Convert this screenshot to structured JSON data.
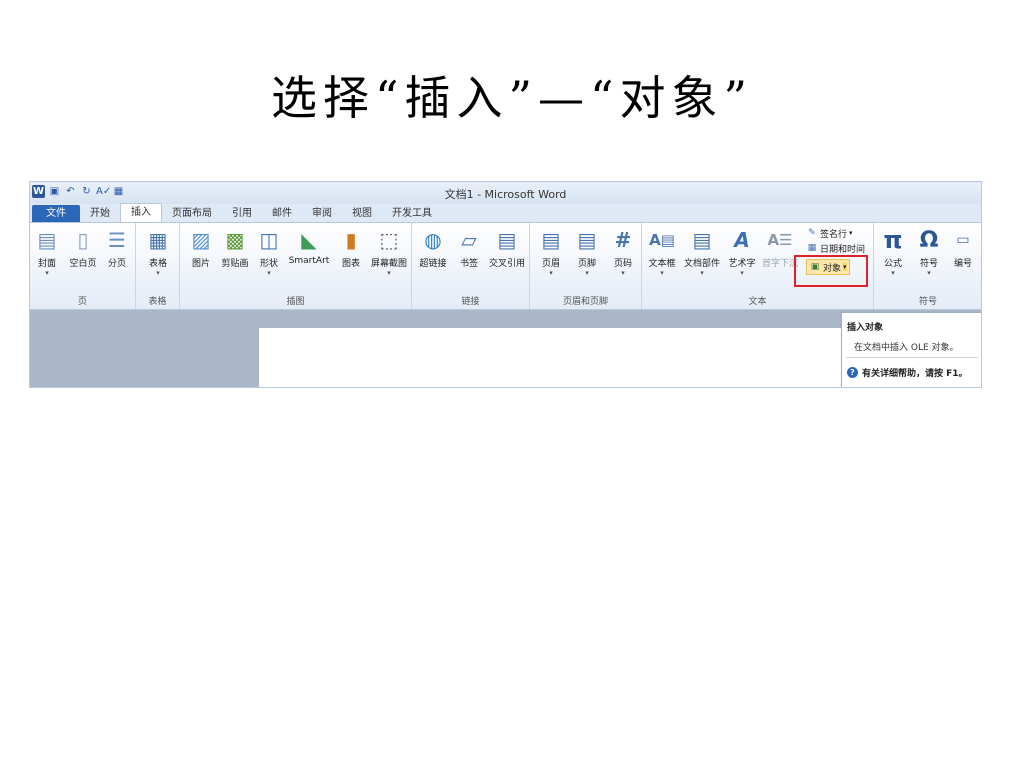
{
  "slide": {
    "title": "选择“插入”—“对象”"
  },
  "window": {
    "title": "文档1 - Microsoft Word",
    "qat": {
      "logo": "W",
      "save": "▣",
      "undo": "↶",
      "redo": "↻",
      "spell": "A✓",
      "table": "▦"
    }
  },
  "tabs": [
    {
      "label": "文件"
    },
    {
      "label": "开始"
    },
    {
      "label": "插入"
    },
    {
      "label": "页面布局"
    },
    {
      "label": "引用"
    },
    {
      "label": "邮件"
    },
    {
      "label": "审阅"
    },
    {
      "label": "视图"
    },
    {
      "label": "开发工具"
    }
  ],
  "ribbon": {
    "groups": {
      "pages": "页",
      "tables": "表格",
      "illustrations": "插图",
      "links": "链接",
      "header_footer": "页眉和页脚",
      "text": "文本",
      "symbols": "符号"
    },
    "buttons": {
      "cover": "封面",
      "blank_page": "空白页",
      "page_break": "分页",
      "table": "表格",
      "picture": "图片",
      "clipart": "剪贴画",
      "shapes": "形状",
      "smartart": "SmartArt",
      "chart": "图表",
      "screenshot": "屏幕截图",
      "hyperlink": "超链接",
      "bookmark": "书签",
      "cross_ref": "交叉引用",
      "header": "页眉",
      "footer": "页脚",
      "page_number": "页码",
      "textbox": "文本框",
      "quick_parts": "文档部件",
      "wordart": "艺术字",
      "dropcap": "首字下沉",
      "signature": "签名行",
      "datetime": "日期和时间",
      "object": "对象",
      "equation": "公式",
      "symbol": "符号",
      "number": "编号"
    }
  },
  "tooltip": {
    "title": "插入对象",
    "description": "在文档中插入 OLE 对象。",
    "help": "有关详细帮助，请按 F1。"
  },
  "colors": {
    "accent": "#2b67b7",
    "highlight": "#e0202a"
  }
}
